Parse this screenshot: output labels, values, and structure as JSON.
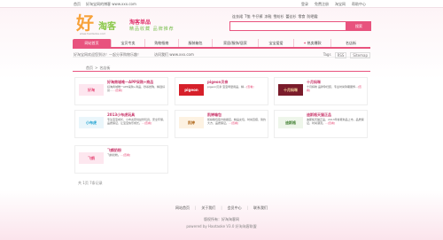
{
  "topbar": {
    "home": "首页",
    "slogan": "好淘宝网的博客 www.xxx.com",
    "links": [
      "登录",
      "免费注册",
      "淘宝网",
      "帮助中心"
    ]
  },
  "logo": {
    "big": "好",
    "tao": "淘客",
    "brand": "淘客单品",
    "tag": "精品收藏 品牌推荐",
    "sub": "www.haotaoke.com"
  },
  "hot_keywords": [
    "连衣裙",
    "T恤",
    "牛仔裤",
    "凉鞋",
    "雪纺衫",
    "蕾丝衫",
    "零食",
    "防晒霜"
  ],
  "search": {
    "placeholder": "",
    "button": "搜索"
  },
  "nav": [
    {
      "label": "网站首页",
      "active": true,
      "hot": false
    },
    {
      "label": "宝贝专卖",
      "active": false,
      "hot": false
    },
    {
      "label": "购物指南",
      "active": false,
      "hot": false
    },
    {
      "label": "服装箱包",
      "active": false,
      "hot": false
    },
    {
      "label": "家居/服饰/居家",
      "active": false,
      "hot": false
    },
    {
      "label": "宝宝爱爱",
      "active": false,
      "hot": false
    },
    {
      "label": "热卖爆款",
      "active": false,
      "hot": true
    },
    {
      "label": "名店街",
      "active": false,
      "hot": false
    }
  ],
  "notice": {
    "text": "好淘宝网欢迎您到访！一起分享购物乐趣！",
    "link": "访问我们 www.xxx.com",
    "tags": [
      "Tags",
      "RSS",
      "Sitemap"
    ]
  },
  "breadcrumb": [
    "首页",
    "名店街"
  ],
  "cards": [
    {
      "title": "好淘商城唯一APP采购+商品",
      "desc": "好淘商城唯一APP采购+商品，秒杀抢购，精选好货...",
      "more": "...[查看]",
      "thumb": "好淘",
      "thumb_bg": "#fde6ef",
      "thumb_color": "#e8537e"
    },
    {
      "title": "pigeon贝亲",
      "desc": "pigeon贝亲 宝宝母婴用品，精...",
      "more": "[查看]",
      "thumb": "pigeon",
      "thumb_bg": "#d6202a",
      "thumb_color": "#ffffff"
    },
    {
      "title": "十月妈咪",
      "desc": "十月妈咪 品牌孕妇装，专业时尚孕期服饰...",
      "more": "[查看]",
      "thumb": "十月妈咪",
      "thumb_bg": "#7a1c2b",
      "thumb_color": "#f6d7a0"
    },
    {
      "title": "2013小布虎玩具",
      "desc": "专注宝宝成长，小布虎原创益智玩具，安全环保，品质保证，让宝宝快乐成长。",
      "more": "...[查看]",
      "thumb": "小布虎",
      "thumb_bg": "#eaf6fb",
      "thumb_color": "#1ea1d0"
    },
    {
      "title": "凯婷箱包",
      "desc": "凯婷箱包官方旗舰店，精品女包，时尚百搭，简约大方，品质保证。",
      "more": "...[查看]",
      "thumb": "凯婷",
      "thumb_bg": "#fdf2e2",
      "thumb_color": "#b06a1e"
    },
    {
      "title": "迪斯格天猫正品",
      "desc": "迪斯格天猫正品，2013年春夏新品上市，品质保证，时尚潮流。",
      "more": "...[查看]",
      "thumb": "迪斯格",
      "thumb_bg": "#eef6ea",
      "thumb_color": "#3e7d2f"
    },
    {
      "title": "飞鹤奶粉",
      "desc": "飞鹤奶粉。",
      "more": "...[查看]",
      "thumb": "飞鹤",
      "thumb_bg": "#fde7ef",
      "thumb_color": "#e8537e"
    }
  ],
  "pager": "共 1页 7条记录",
  "footer": {
    "links": [
      "网站首页",
      "关于我们",
      "会员中心",
      "联系我们"
    ],
    "copyright": "版权所有：好淘淘客网",
    "powered": "powered by Haotaoke V3.0 好淘淘客联盟"
  }
}
